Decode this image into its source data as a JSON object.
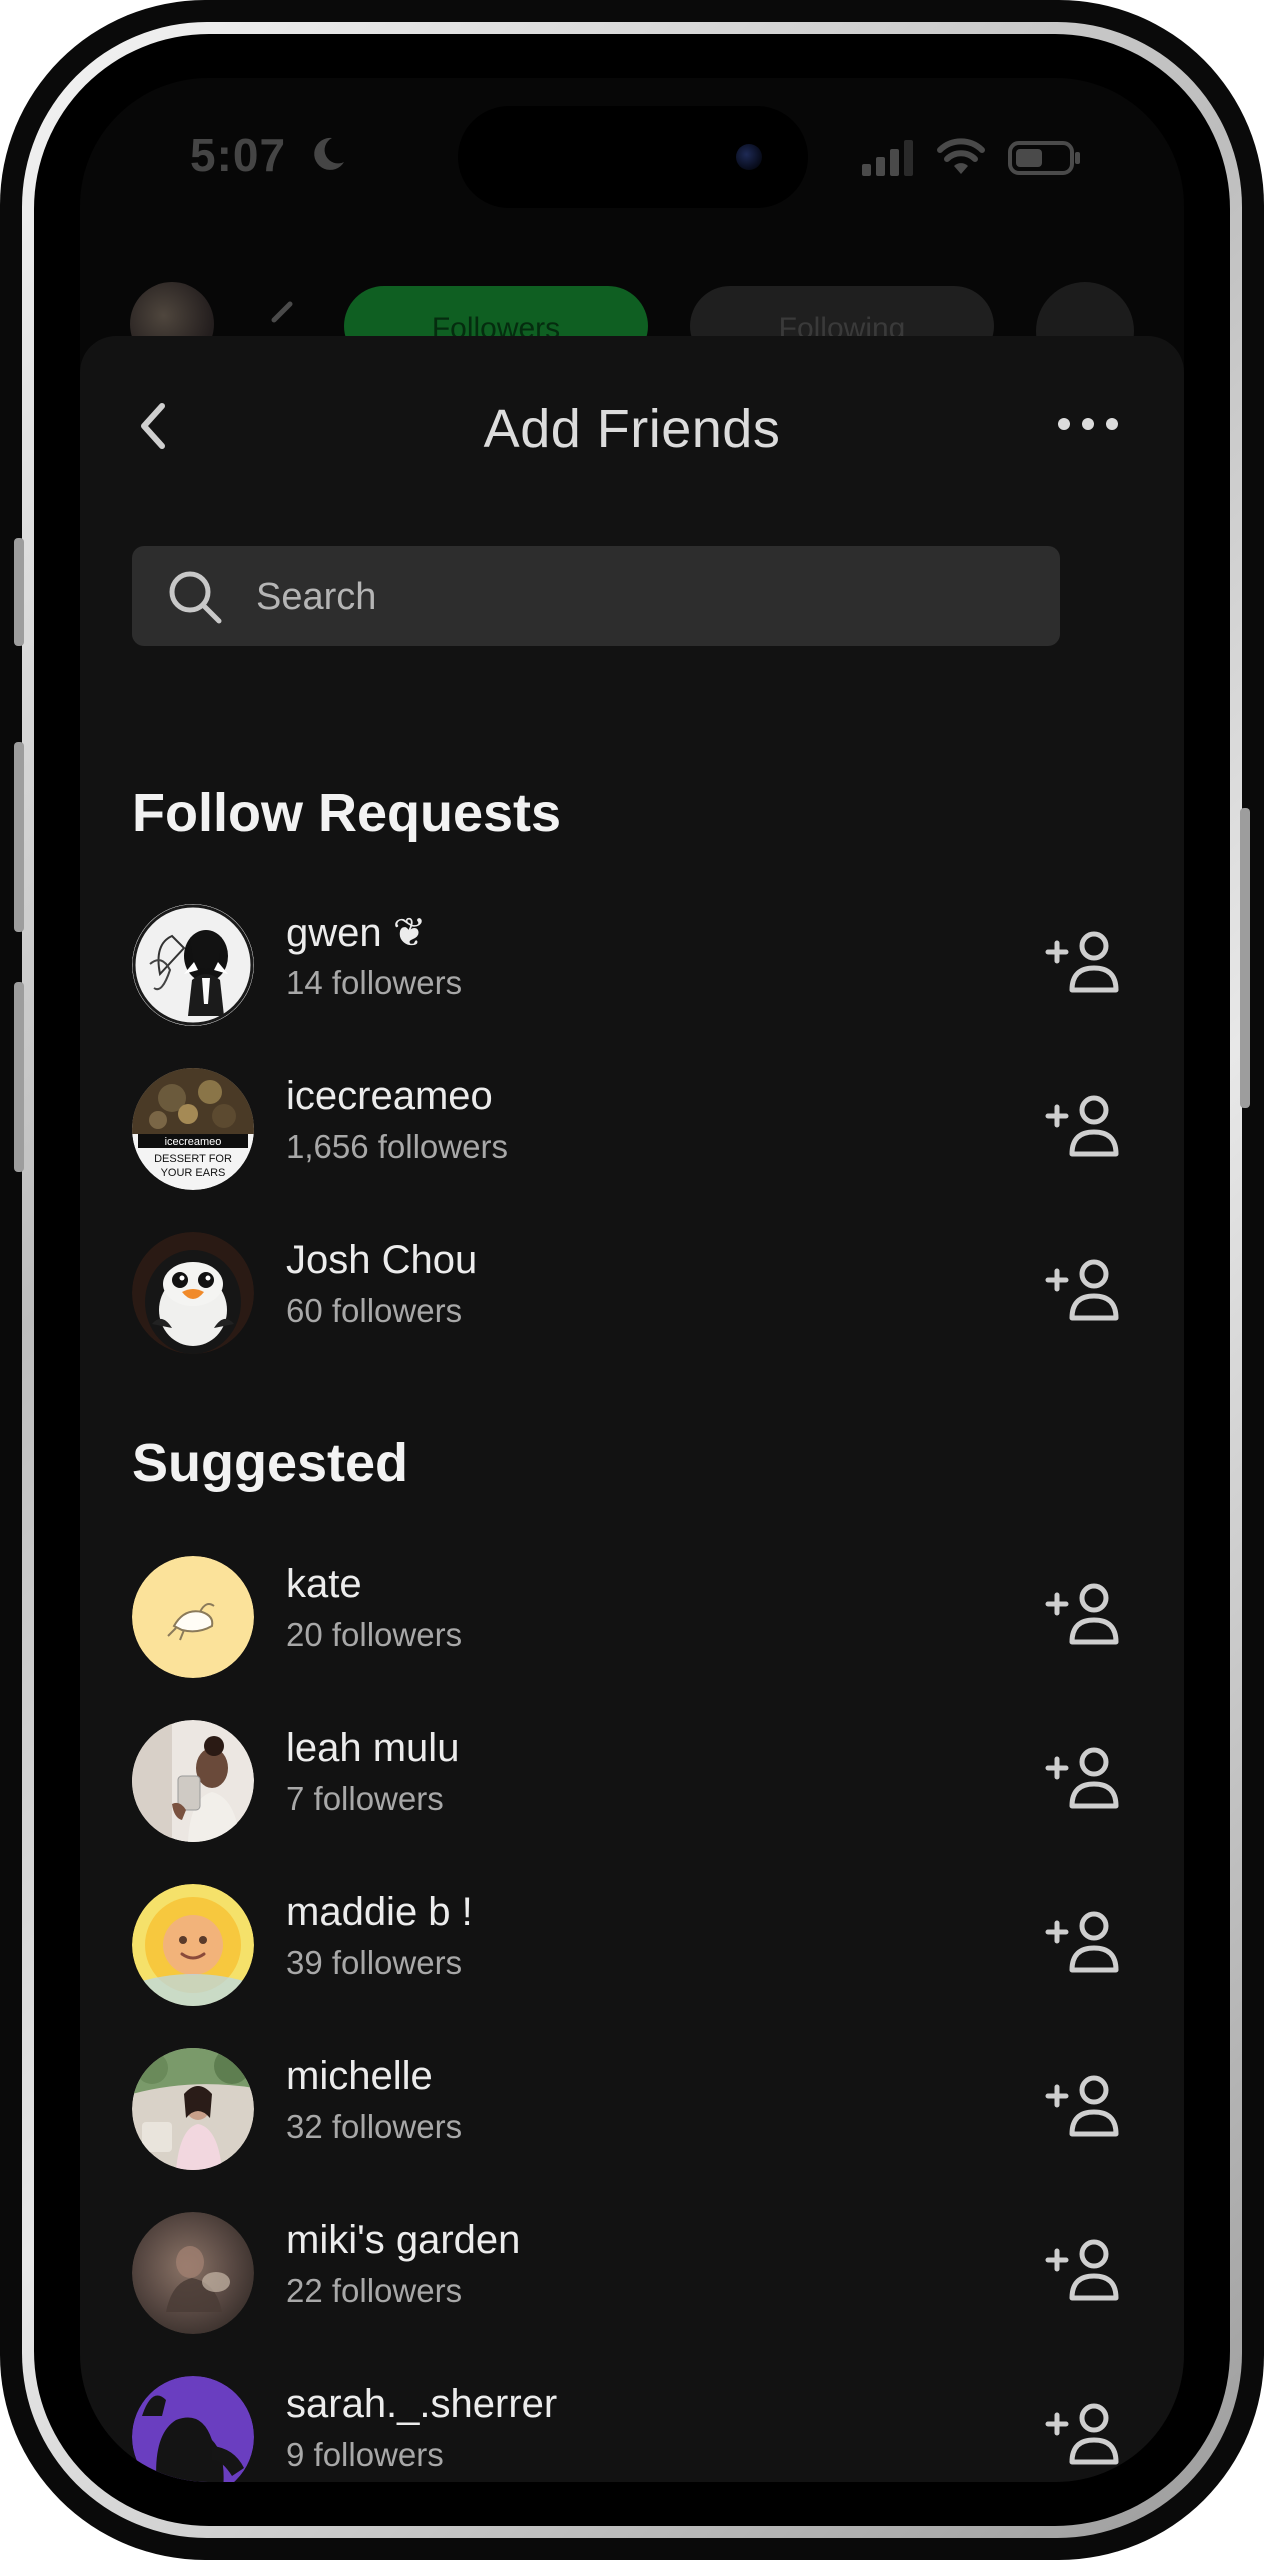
{
  "status_bar": {
    "time": "5:07",
    "icons": [
      "moon-icon",
      "signal-icon",
      "wifi-icon",
      "battery-icon"
    ]
  },
  "background_peek": {
    "tabs": [
      "Followers",
      "Following"
    ]
  },
  "header": {
    "title": "Add Friends",
    "back_icon": "chevron-left-icon",
    "more_icon": "ellipsis-icon"
  },
  "search": {
    "placeholder": "Search",
    "value": ""
  },
  "follow_requests": {
    "heading": "Follow Requests",
    "items": [
      {
        "name": "gwen ❦",
        "followers": "14 followers",
        "avatar": "sketch-portrait"
      },
      {
        "name": "icecreameo",
        "followers": "1,656 followers",
        "avatar": "icecreameo-logo",
        "avatar_text": [
          "icecreameo",
          "DESSERT FOR",
          "YOUR EARS"
        ]
      },
      {
        "name": "Josh Chou",
        "followers": "60 followers",
        "avatar": "penguin-plush"
      }
    ]
  },
  "suggested": {
    "heading": "Suggested",
    "items": [
      {
        "name": "kate",
        "followers": "20 followers",
        "avatar": "bird-doodle-yellow"
      },
      {
        "name": "leah mulu",
        "followers": "7 followers",
        "avatar": "mirror-selfie"
      },
      {
        "name": "maddie b !",
        "followers": "39 followers",
        "avatar": "sun-baby"
      },
      {
        "name": "michelle",
        "followers": "32 followers",
        "avatar": "garden-portrait"
      },
      {
        "name": "miki's garden",
        "followers": "22 followers",
        "avatar": "blurred-photo"
      },
      {
        "name": "sarah._.sherrer",
        "followers": "9 followers",
        "avatar": "purple-silhouette"
      }
    ]
  },
  "colors": {
    "background": "#070707",
    "sheet": "#121212",
    "search_field": "#2d2d2d",
    "accent_green": "#0f5f22",
    "text_primary": "#ececec",
    "text_secondary": "#a8a8a8"
  }
}
